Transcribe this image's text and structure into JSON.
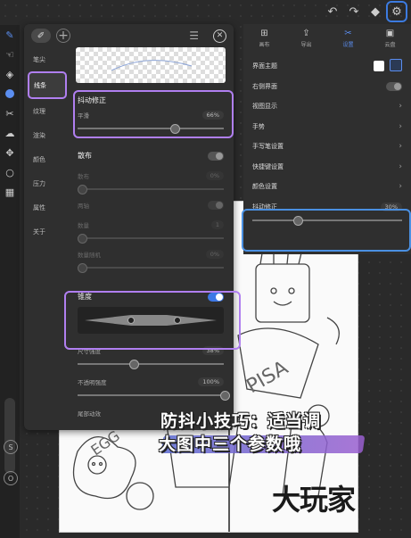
{
  "colors": {
    "accent_blue": "#3d78e6",
    "highlight_purple": "#b07ff0",
    "highlight_blue": "#4a90e2",
    "theme_light": "#ffffff",
    "theme_dark": "#2b3a55"
  },
  "topbar": {
    "undo_icon": "undo-icon",
    "redo_icon": "redo-icon",
    "layers_icon": "layers-icon",
    "settings_icon": "gear-icon"
  },
  "brush_panel": {
    "categories": [
      "笔尖",
      "线条",
      "纹理",
      "渲染",
      "颜色",
      "压力",
      "属性",
      "关于"
    ],
    "selected_category": "线条",
    "stabilization": {
      "title": "抖动修正",
      "smoothing_label": "平滑",
      "smoothing_value": "66%",
      "smoothing_level": 0.66
    },
    "scatter": {
      "title": "散布",
      "enabled": false,
      "items": [
        {
          "label": "散布",
          "value": "0%"
        },
        {
          "label": "两轴",
          "value": ""
        },
        {
          "label": "数量",
          "value": "1"
        },
        {
          "label": "数量随机",
          "value": "0%"
        }
      ]
    },
    "taper": {
      "title": "锥度",
      "enabled": true
    },
    "size_strength": {
      "label": "尺寸强度",
      "value": "38%",
      "level": 0.38
    },
    "opacity_strength": {
      "label": "不透明强度",
      "value": "100%",
      "level": 1.0
    },
    "tail_effect": {
      "label": "尾部动效"
    }
  },
  "settings_panel": {
    "tabs": [
      {
        "label": "画布",
        "icon": "canvas-icon"
      },
      {
        "label": "导出",
        "icon": "export-icon"
      },
      {
        "label": "设置",
        "icon": "tools-icon"
      },
      {
        "label": "云盘",
        "icon": "cloud-folder-icon"
      }
    ],
    "selected_tab": "设置",
    "rows": [
      {
        "label": "界面主题",
        "type": "theme"
      },
      {
        "label": "右侧界面",
        "type": "toggle"
      },
      {
        "label": "视图显示",
        "type": "chevron"
      },
      {
        "label": "手势",
        "type": "chevron"
      },
      {
        "label": "手写笔设置",
        "type": "chevron"
      },
      {
        "label": "快捷键设置",
        "type": "chevron"
      },
      {
        "label": "颜色设置",
        "type": "chevron"
      }
    ],
    "stabilization": {
      "label": "抖动修正",
      "value": "30%",
      "level": 0.3
    }
  },
  "caption": {
    "line1": "防抖小技巧：适当调",
    "line2": "大图中三个参数哦"
  },
  "watermark": "大玩家"
}
